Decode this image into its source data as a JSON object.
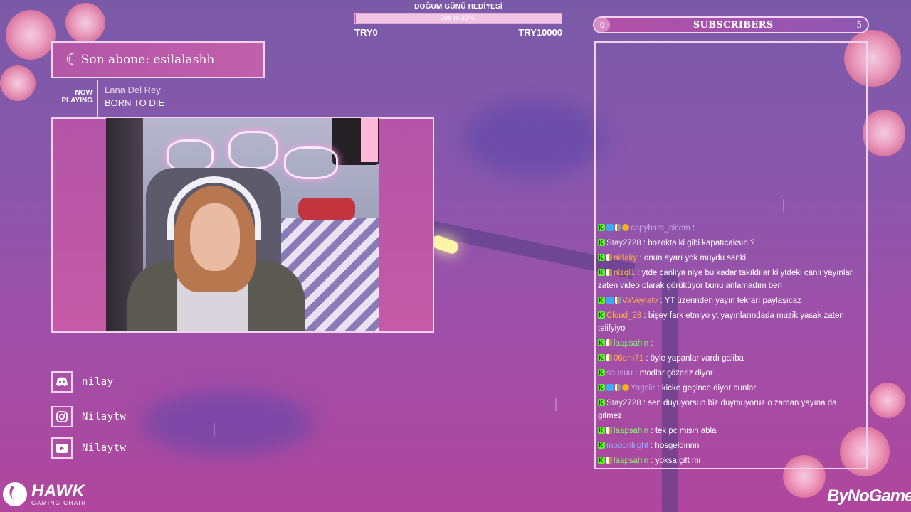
{
  "goal": {
    "title": "DOĞUM GÜNÜ HEDİYESİ",
    "progress_label": "20₺ (0.20%)",
    "progress_fraction": 0.002,
    "min_label": "TRY0",
    "max_label": "TRY10000"
  },
  "subscribers": {
    "left_count": "0",
    "label": "SUBSCRIBERS",
    "right_count": "5"
  },
  "last_sub": {
    "icon": "moon-icon",
    "text": "Son abone: esilalashh"
  },
  "now_playing": {
    "label_line1": "NOW",
    "label_line2": "PLAYING",
    "artist": "Lana Del Rey",
    "song": "BORN TO DIE"
  },
  "socials": [
    {
      "icon": "discord-icon",
      "name": "nilay"
    },
    {
      "icon": "instagram-icon",
      "name": "Nilaytw"
    },
    {
      "icon": "youtube-icon",
      "name": "Nilaytw"
    }
  ],
  "chat": [
    {
      "badges": [
        "k",
        "blue",
        "bar",
        "gold"
      ],
      "user": "capybara_cicem",
      "color": "#c7a6e6",
      "text": ""
    },
    {
      "badges": [
        "k"
      ],
      "user": "Stay2728",
      "color": "#e4e4e4",
      "text": "bozokta ki gibi kapatıcaksın ?"
    },
    {
      "badges": [
        "k",
        "bar"
      ],
      "user": "nidaky",
      "color": "#ffb347",
      "text": "onun ayarı yok muydu sanki"
    },
    {
      "badges": [
        "k",
        "bar"
      ],
      "user": "nizqi1",
      "color": "#ffb347",
      "text": "ytde canlıya niye bu kadar takıldılar ki ytdeki canlı yayınlar zaten video olarak görüküyor bunu anlamadım ben"
    },
    {
      "badges": [
        "k",
        "blue",
        "bar"
      ],
      "user": "VaVeylatv",
      "color": "#ffb347",
      "text": "YT üzerinden yayın tekrarı paylaşıcaz"
    },
    {
      "badges": [
        "k"
      ],
      "user": "Cloud_28",
      "color": "#ffb347",
      "text": "bişey fark etmiyo yt yayınlarındada muzik yasak zaten telifyiyo"
    },
    {
      "badges": [
        "k",
        "bar"
      ],
      "user": "laapsahin",
      "color": "#7cfc6a",
      "text": ""
    },
    {
      "badges": [
        "k",
        "bar"
      ],
      "user": "06ern71",
      "color": "#ffb347",
      "text": "öyle yapanlar vardı galiba"
    },
    {
      "badges": [
        "k"
      ],
      "user": "sausuu",
      "color": "#c7a6e6",
      "text": "modlar çözeriz diyor"
    },
    {
      "badges": [
        "k",
        "blue",
        "bar",
        "gold"
      ],
      "user": "Yagsiir",
      "color": "#c7a6e6",
      "text": "kicke geçince diyor bunlar"
    },
    {
      "badges": [
        "k"
      ],
      "user": "Stay2728",
      "color": "#e4e4e4",
      "text": "sen duyuyorsun biz duymuyoruz o zaman yayına da gitmez"
    },
    {
      "badges": [
        "k",
        "bar"
      ],
      "user": "laapsahin",
      "color": "#7cfc6a",
      "text": "tek pc misin abla"
    },
    {
      "badges": [
        "k"
      ],
      "user": "mooonliight",
      "color": "#8fb4ff",
      "text": "hosgeldinnn"
    },
    {
      "badges": [
        "k",
        "bar"
      ],
      "user": "laapsahin",
      "color": "#7cfc6a",
      "text": "yoksa çift mi"
    }
  ],
  "branding": {
    "left_big": "HAWK",
    "left_small": "GAMING CHAIR",
    "right": "ByNoGame"
  }
}
